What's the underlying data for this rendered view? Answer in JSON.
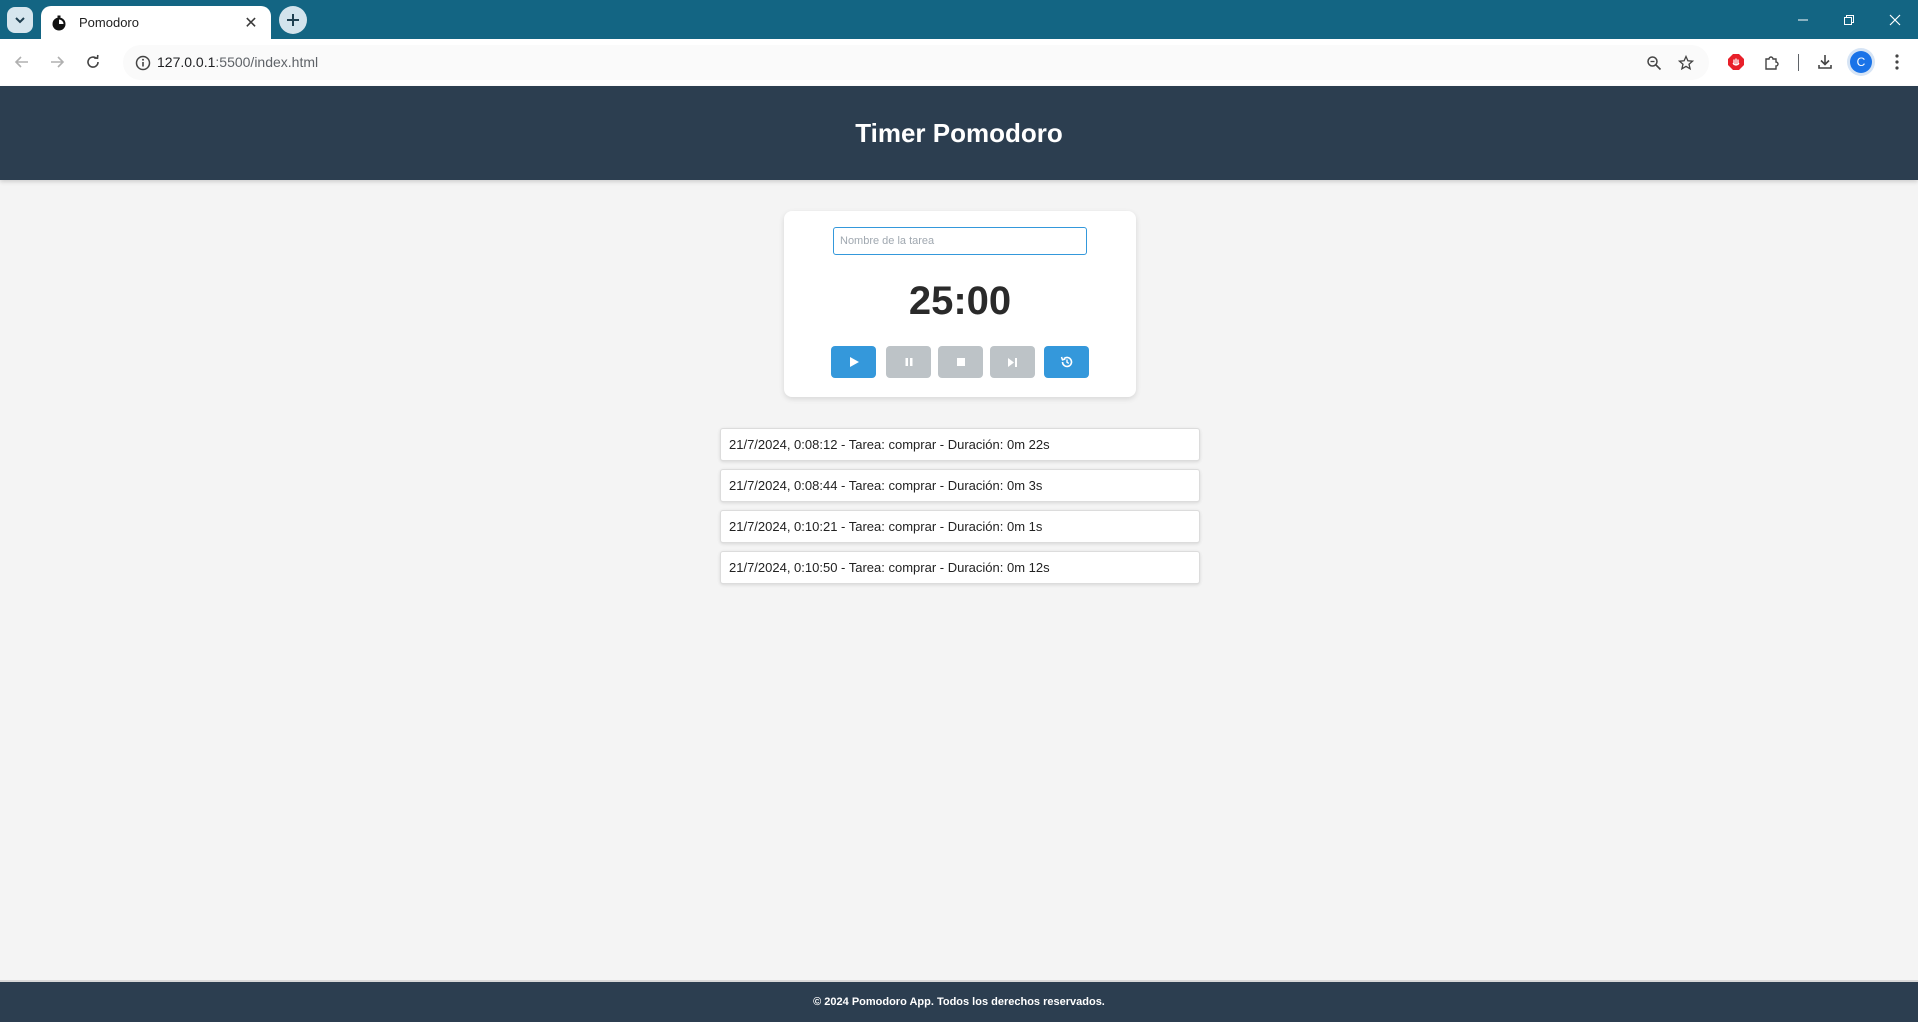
{
  "browser": {
    "tab_title": "Pomodoro",
    "url_host": "127.0.0.1",
    "url_rest": ":5500/index.html",
    "profile_initial": "C"
  },
  "header": {
    "title": "Timer Pomodoro"
  },
  "timer": {
    "task_placeholder": "Nombre de la tarea",
    "task_value": "",
    "display": "25:00",
    "controls": [
      {
        "name": "start",
        "icon": "play-icon",
        "enabled": true
      },
      {
        "name": "pause",
        "icon": "pause-icon",
        "enabled": false
      },
      {
        "name": "stop",
        "icon": "stop-icon",
        "enabled": false
      },
      {
        "name": "skip",
        "icon": "skip-next-icon",
        "enabled": false
      },
      {
        "name": "reset",
        "icon": "history-icon",
        "enabled": true
      }
    ]
  },
  "history": [
    "21/7/2024, 0:08:12 - Tarea: comprar - Duración: 0m 22s",
    "21/7/2024, 0:08:44 - Tarea: comprar - Duración: 0m 3s",
    "21/7/2024, 0:10:21 - Tarea: comprar - Duración: 0m 1s",
    "21/7/2024, 0:10:50 - Tarea: comprar - Duración: 0m 12s"
  ],
  "footer": {
    "text": "© 2024 Pomodoro App. Todos los derechos reservados."
  },
  "colors": {
    "header_bg": "#2c3e50",
    "accent": "#3498db",
    "disabled": "#bdc3c7",
    "page_bg": "#f4f4f4"
  }
}
